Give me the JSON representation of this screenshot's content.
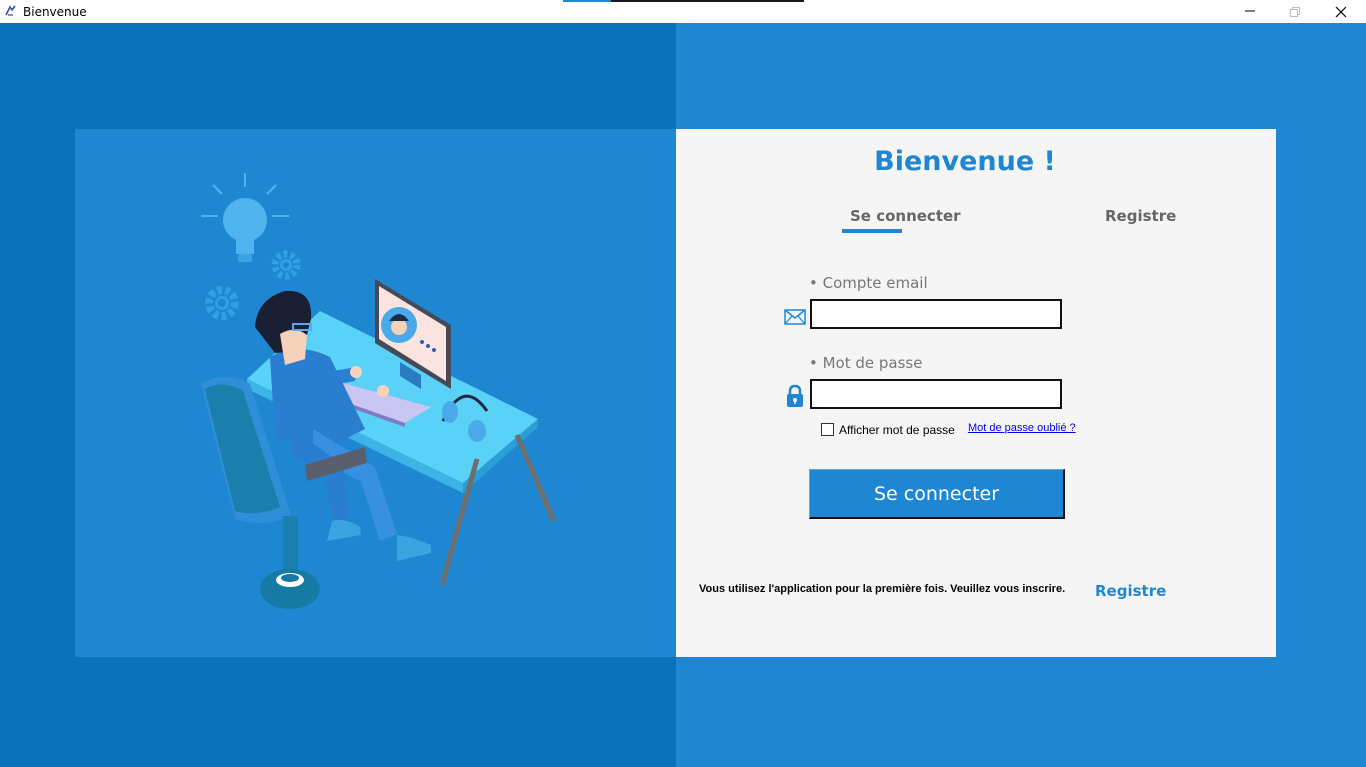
{
  "window": {
    "title": "Bienvenue",
    "icon": "app-icon",
    "controls": [
      "minimize-icon",
      "restore-icon",
      "close-icon"
    ]
  },
  "colors": {
    "accent": "#1f86d2",
    "dark_accent": "#0b72ba",
    "form_background": "#f5f5f5",
    "link": "#0000ee"
  },
  "illustration": {
    "icon": "developer-at-desk-illustration"
  },
  "login": {
    "heading": "Bienvenue !",
    "tabs": [
      {
        "label": "Se connecter",
        "active": true
      },
      {
        "label": "Registre",
        "active": false
      }
    ],
    "email": {
      "label": "• Compte email",
      "value": "",
      "icon": "mail-icon"
    },
    "password": {
      "label": "• Mot de passe",
      "value": "",
      "icon": "lock-icon"
    },
    "show_password": {
      "label": "Afficher mot de passe",
      "checked": false
    },
    "forgot_password": "Mot de passe oublié ?",
    "submit": "Se connecter",
    "footer_text": "Vous utilisez l'application pour la première fois. Veuillez vous inscrire.",
    "footer_link": "Registre"
  }
}
